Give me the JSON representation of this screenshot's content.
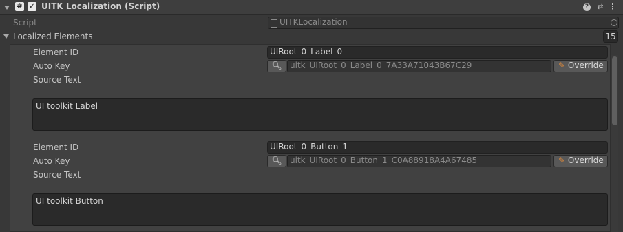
{
  "component": {
    "title": "UITK Localization (Script)",
    "script_label": "Script",
    "script_value": "UITKLocalization"
  },
  "list": {
    "label": "Localized Elements",
    "count": "15",
    "items": [
      {
        "element_id_label": "Element ID",
        "element_id_value": "UIRoot_0_Label_0",
        "auto_key_label": "Auto Key",
        "auto_key_value": "uitk_UIRoot_0_Label_0_7A33A71043B67C29",
        "override_label": "Override",
        "source_text_label": "Source Text",
        "source_text_value": "UI toolkit Label"
      },
      {
        "element_id_label": "Element ID",
        "element_id_value": "UIRoot_0_Button_1",
        "auto_key_label": "Auto Key",
        "auto_key_value": "uitk_UIRoot_0_Button_1_C0A88918A4A67485",
        "override_label": "Override",
        "source_text_label": "Source Text",
        "source_text_value": "UI toolkit Button"
      }
    ]
  },
  "icons": {
    "foldout": "triangle-down-icon",
    "script": "hash-icon",
    "enabled": "checkmark-icon",
    "help": "question-icon",
    "preset": "sliders-icon",
    "menu": "kebab-menu-icon",
    "search": "magnifier-icon",
    "override": "pencil-icon",
    "object_picker": "target-icon"
  }
}
